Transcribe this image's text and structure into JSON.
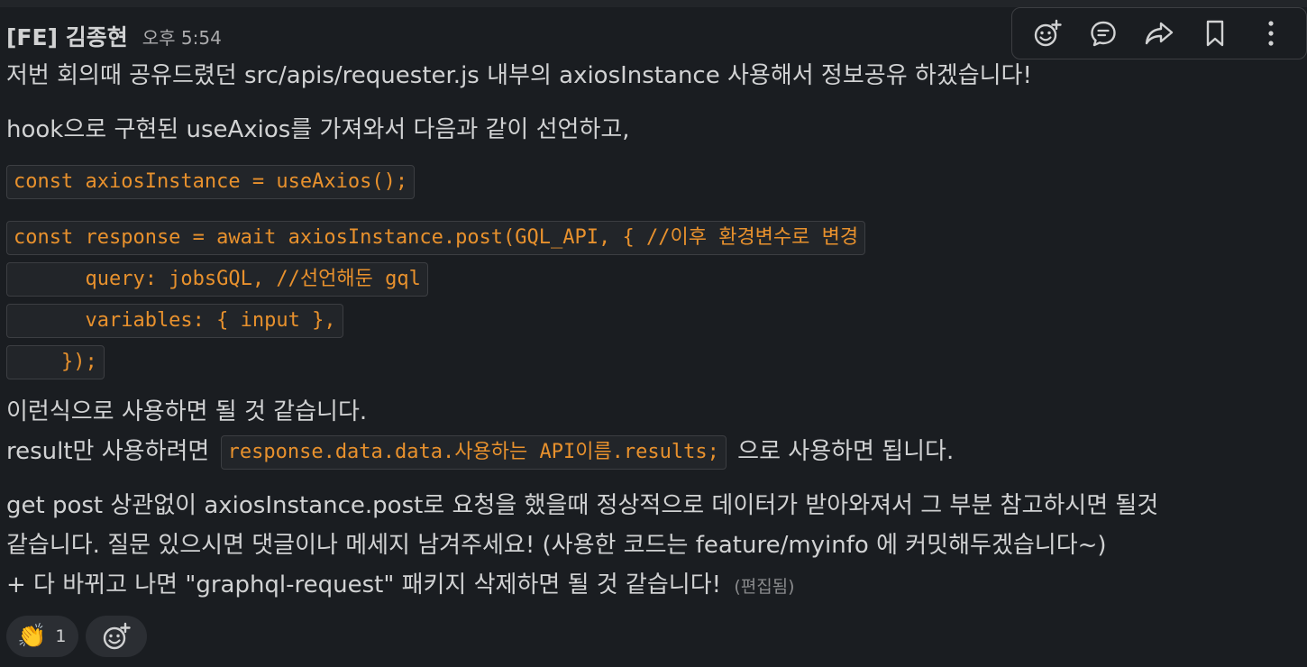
{
  "message": {
    "author": "[FE] 김종현",
    "timestamp": "오후 5:54",
    "line1": "저번 회의때 공유드렸던 src/apis/requester.js 내부의 axiosInstance 사용해서 정보공유 하겠습니다!",
    "line2": "hook으로 구현된 useAxios를 가져와서 다음과 같이 선언하고,",
    "code_declare": "const axiosInstance = useAxios();",
    "code_block": [
      "const response = await axiosInstance.post(GQL_API, { //이후 환경변수로 변경",
      "      query: jobsGQL, //선언해둔 gql",
      "      variables: { input },",
      "    });"
    ],
    "line3": "이런식으로 사용하면 될 것 같습니다.",
    "line4_before": "result만 사용하려면",
    "line4_code": "response.data.data.사용하는 API이름.results;",
    "line4_after": "으로 사용하면 됩니다.",
    "line5": "get post 상관없이 axiosInstance.post로 요청을 했을때 정상적으로 데이터가 받아와져서 그 부분 참고하시면 될것",
    "line6": "같습니다. 질문 있으시면 댓글이나 메세지 남겨주세요! (사용한 코드는 feature/myinfo 에 커밋해두겠습니다~)",
    "line7": "+ 다 바뀌고 나면 \"graphql-request\" 패키지 삭제하면 될 것 같습니다!",
    "edited": "(편집됨)"
  },
  "reactions": [
    {
      "emoji": "👏",
      "count": "1"
    }
  ],
  "toolbar": {
    "icons": [
      "add-reaction-icon",
      "reply-thread-icon",
      "share-icon",
      "bookmark-icon",
      "more-actions-icon"
    ]
  },
  "colors": {
    "background": "#1a1d21",
    "text": "#d1d2d3",
    "code_text": "#e8912d",
    "code_background": "#222529"
  }
}
